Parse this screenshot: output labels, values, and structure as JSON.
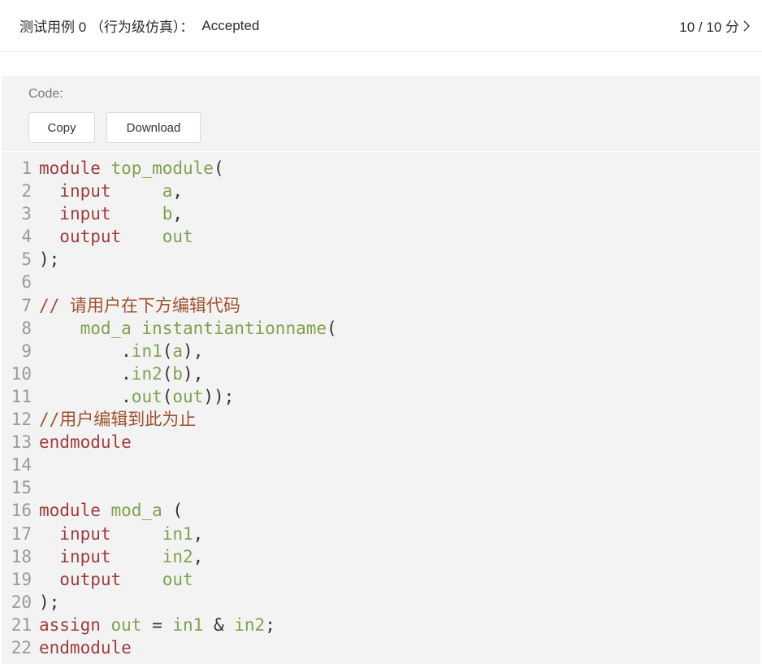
{
  "header": {
    "title": "测试用例 0 （行为级仿真）：",
    "status": "Accepted",
    "score": "10 / 10 分"
  },
  "panel": {
    "code_label": "Code:",
    "copy_label": "Copy",
    "download_label": "Download"
  },
  "code_lines": [
    {
      "n": "1",
      "seg": [
        [
          "kw",
          "module"
        ],
        [
          "pn",
          " "
        ],
        [
          "id",
          "top_module"
        ],
        [
          "pn",
          "("
        ]
      ]
    },
    {
      "n": "2",
      "seg": [
        [
          "pn",
          "  "
        ],
        [
          "kw",
          "input"
        ],
        [
          "pn",
          "     "
        ],
        [
          "id",
          "a"
        ],
        [
          "pn",
          ","
        ]
      ]
    },
    {
      "n": "3",
      "seg": [
        [
          "pn",
          "  "
        ],
        [
          "kw",
          "input"
        ],
        [
          "pn",
          "     "
        ],
        [
          "id",
          "b"
        ],
        [
          "pn",
          ","
        ]
      ]
    },
    {
      "n": "4",
      "seg": [
        [
          "pn",
          "  "
        ],
        [
          "kw",
          "output"
        ],
        [
          "pn",
          "    "
        ],
        [
          "id",
          "out"
        ]
      ]
    },
    {
      "n": "5",
      "seg": [
        [
          "pn",
          ");"
        ]
      ]
    },
    {
      "n": "6",
      "seg": []
    },
    {
      "n": "7",
      "seg": [
        [
          "cm",
          "// 请用户在下方编辑代码"
        ]
      ]
    },
    {
      "n": "8",
      "seg": [
        [
          "pn",
          "    "
        ],
        [
          "id",
          "mod_a instantiantionname"
        ],
        [
          "pn",
          "("
        ]
      ]
    },
    {
      "n": "9",
      "seg": [
        [
          "pn",
          "        ."
        ],
        [
          "id",
          "in1"
        ],
        [
          "pn",
          "("
        ],
        [
          "id",
          "a"
        ],
        [
          "pn",
          "),"
        ]
      ]
    },
    {
      "n": "10",
      "seg": [
        [
          "pn",
          "        ."
        ],
        [
          "id",
          "in2"
        ],
        [
          "pn",
          "("
        ],
        [
          "id",
          "b"
        ],
        [
          "pn",
          "),"
        ]
      ]
    },
    {
      "n": "11",
      "seg": [
        [
          "pn",
          "        ."
        ],
        [
          "id",
          "out"
        ],
        [
          "pn",
          "("
        ],
        [
          "id",
          "out"
        ],
        [
          "pn",
          "));"
        ]
      ]
    },
    {
      "n": "12",
      "seg": [
        [
          "cm",
          "//用户编辑到此为止"
        ]
      ]
    },
    {
      "n": "13",
      "seg": [
        [
          "kw",
          "endmodule"
        ]
      ]
    },
    {
      "n": "14",
      "seg": []
    },
    {
      "n": "15",
      "seg": []
    },
    {
      "n": "16",
      "seg": [
        [
          "kw",
          "module"
        ],
        [
          "pn",
          " "
        ],
        [
          "id",
          "mod_a"
        ],
        [
          "pn",
          " ("
        ]
      ]
    },
    {
      "n": "17",
      "seg": [
        [
          "pn",
          "  "
        ],
        [
          "kw",
          "input"
        ],
        [
          "pn",
          "     "
        ],
        [
          "id",
          "in1"
        ],
        [
          "pn",
          ","
        ]
      ]
    },
    {
      "n": "18",
      "seg": [
        [
          "pn",
          "  "
        ],
        [
          "kw",
          "input"
        ],
        [
          "pn",
          "     "
        ],
        [
          "id",
          "in2"
        ],
        [
          "pn",
          ","
        ]
      ]
    },
    {
      "n": "19",
      "seg": [
        [
          "pn",
          "  "
        ],
        [
          "kw",
          "output"
        ],
        [
          "pn",
          "    "
        ],
        [
          "id",
          "out"
        ]
      ]
    },
    {
      "n": "20",
      "seg": [
        [
          "pn",
          ");"
        ]
      ]
    },
    {
      "n": "21",
      "seg": [
        [
          "kw",
          "assign"
        ],
        [
          "pn",
          " "
        ],
        [
          "id",
          "out"
        ],
        [
          "pn",
          " = "
        ],
        [
          "id",
          "in1"
        ],
        [
          "pn",
          " & "
        ],
        [
          "id",
          "in2"
        ],
        [
          "pn",
          ";"
        ]
      ]
    },
    {
      "n": "22",
      "seg": [
        [
          "kw",
          "endmodule"
        ]
      ]
    }
  ]
}
